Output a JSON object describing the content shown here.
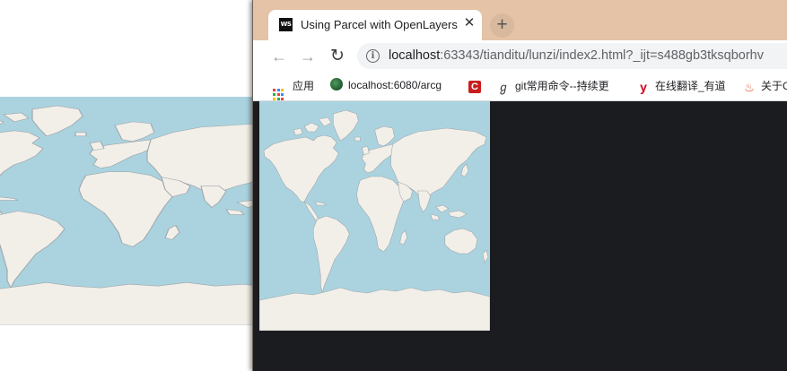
{
  "browser": {
    "tab": {
      "favicon_text": "WS",
      "title": "Using Parcel with OpenLayers",
      "close_glyph": "✕"
    },
    "new_tab_glyph": "+",
    "nav": {
      "back_glyph": "←",
      "forward_glyph": "→",
      "reload_glyph": "↻"
    },
    "address": {
      "host": "localhost",
      "rest": ":63343/tianditu/lunzi/index2.html?_ijt=s488gb3tksqborhv"
    },
    "bookmarks": [
      {
        "label": "应用",
        "icon": "apps-grid-icon"
      },
      {
        "label": "localhost:6080/arcg",
        "icon": "globe-icon"
      },
      {
        "label": "",
        "icon": "c-icon"
      },
      {
        "label": "git常用命令--持续更",
        "icon": "git-icon"
      },
      {
        "label": "在线翻译_有道",
        "icon": "youdao-icon"
      },
      {
        "label": "关于C",
        "icon": "fire-icon"
      }
    ]
  },
  "colors": {
    "ocean": "#aad3df",
    "land": "#f2efe9",
    "coast": "#a1a7ad",
    "tab_strip": "#e4c3a6",
    "content_bg": "#1b1c1f"
  }
}
